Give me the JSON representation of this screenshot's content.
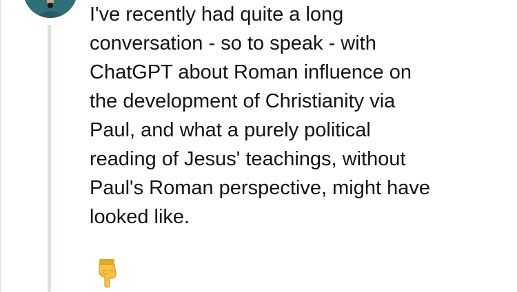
{
  "post": {
    "lines": [
      "I've recently had quite a long",
      "conversation - so to speak - with",
      "ChatGPT about Roman influence on",
      "the development of Christianity via",
      "Paul, and what a purely political",
      "reading of Jesus' teachings, without",
      "Paul's Roman perspective, might have",
      "looked like."
    ],
    "emoji_icon": "backhand-index-pointing-down-icon"
  },
  "colors": {
    "text": "#0f1419",
    "thread_line": "#dcdfe5",
    "emoji": "#f6c343"
  }
}
